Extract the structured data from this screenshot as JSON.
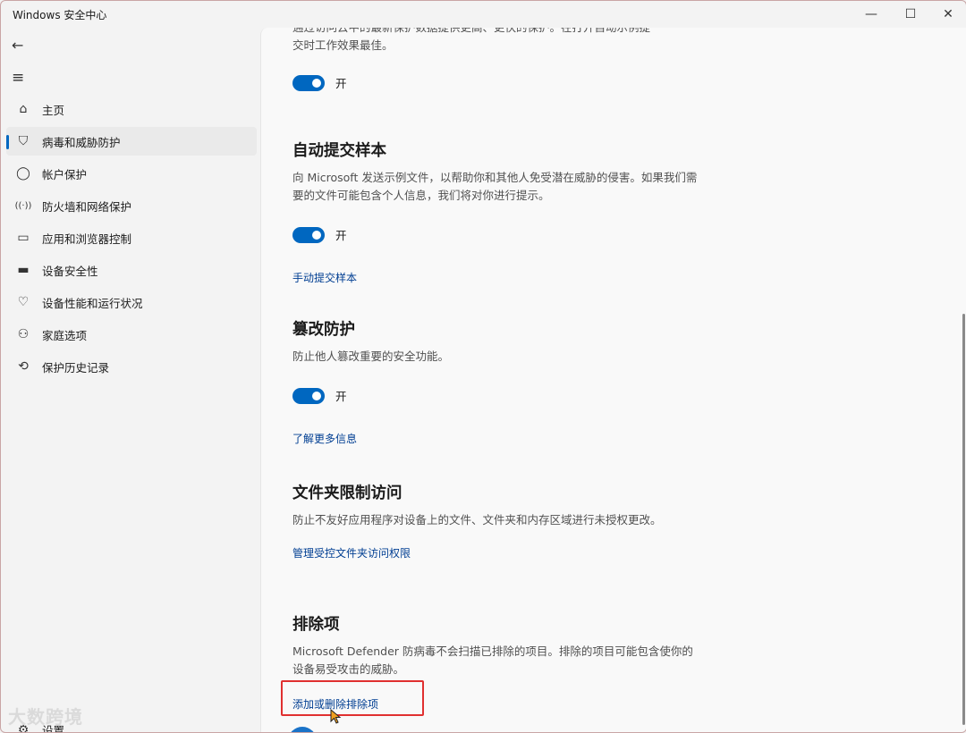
{
  "window": {
    "title": "Windows 安全中心"
  },
  "nav": {
    "items": [
      {
        "label": "主页",
        "icon": "home-icon",
        "glyph": "⌂"
      },
      {
        "label": "病毒和威胁防护",
        "icon": "shield-icon",
        "glyph": "⛉",
        "active": true
      },
      {
        "label": "帐户保护",
        "icon": "person-icon",
        "glyph": "👤"
      },
      {
        "label": "防火墙和网络保护",
        "icon": "wireless-icon",
        "glyph": "((·))"
      },
      {
        "label": "应用和浏览器控制",
        "icon": "app-window-icon",
        "glyph": "▭"
      },
      {
        "label": "设备安全性",
        "icon": "laptop-icon",
        "glyph": "💻"
      },
      {
        "label": "设备性能和运行状况",
        "icon": "heart-pulse-icon",
        "glyph": "♡"
      },
      {
        "label": "家庭选项",
        "icon": "family-icon",
        "glyph": "👪"
      },
      {
        "label": "保护历史记录",
        "icon": "history-icon",
        "glyph": "⟲"
      }
    ],
    "settings_label": "设置"
  },
  "watermark": "大数跨境",
  "content": {
    "cloud_section": {
      "desc_lines": [
        "通过访问云中的最新保护数据提供更高、更快的保护。在打开自动示例提",
        "交时工作效果最佳。"
      ],
      "toggle_label": "开"
    },
    "auto_sample": {
      "title": "自动提交样本",
      "desc": "向 Microsoft 发送示例文件，以帮助你和其他人免受潜在威胁的侵害。如果我们需要的文件可能包含个人信息，我们将对你进行提示。",
      "toggle_label": "开",
      "link": "手动提交样本"
    },
    "tamper": {
      "title": "篡改防护",
      "desc": "防止他人篡改重要的安全功能。",
      "toggle_label": "开",
      "link": "了解更多信息"
    },
    "folder_access": {
      "title": "文件夹限制访问",
      "desc": "防止不友好应用程序对设备上的文件、文件夹和内存区域进行未授权更改。",
      "link": "管理受控文件夹访问权限"
    },
    "exclusions": {
      "title": "排除项",
      "desc": "Microsoft Defender 防病毒不会扫描已排除的项目。排除的项目可能包含使你的设备易受攻击的威胁。",
      "link": "添加或删除排除项"
    }
  }
}
